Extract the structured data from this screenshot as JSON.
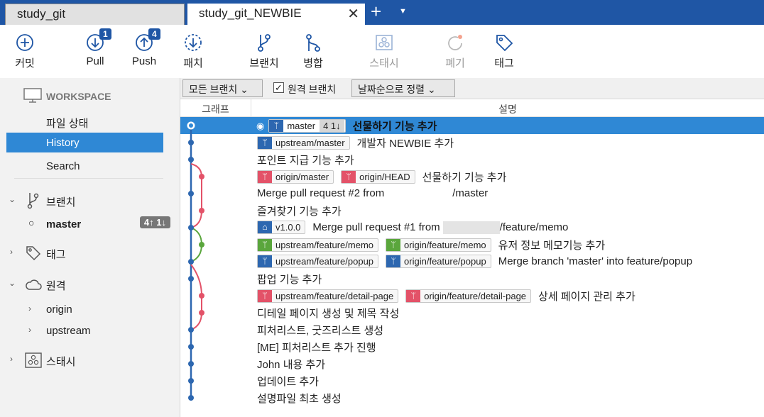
{
  "tabs": [
    {
      "label": "study_git"
    },
    {
      "label": "study_git_NEWBIE"
    }
  ],
  "tab_close": "✕",
  "add_tab": "+",
  "tab_menu": "▼",
  "toolbar": {
    "commit": "커밋",
    "pull": "Pull",
    "pull_badge": "1",
    "push": "Push",
    "push_badge": "4",
    "patch": "패치",
    "branch": "브랜치",
    "merge": "병합",
    "stash": "스태시",
    "discard": "폐기",
    "tag": "태그"
  },
  "sidebar": {
    "workspace": "WORKSPACE",
    "file_status": "파일 상태",
    "history": "History",
    "search": "Search",
    "branches": "브랜치",
    "master": "master",
    "master_count": "4↑ 1↓",
    "tags": "태그",
    "remotes": "원격",
    "origin": "origin",
    "upstream": "upstream",
    "stash": "스태시"
  },
  "filter": {
    "all_branches": "모든 브랜치 ⌄",
    "remote_branches": "원격 브랜치",
    "remote_checked": "✓",
    "sort": "날짜순으로 정렬 ⌄"
  },
  "columns": {
    "graph": "그래프",
    "desc": "설명"
  },
  "commits": [
    {
      "refs": [
        {
          "name": "master",
          "kind": "head",
          "count": "4 1↓"
        }
      ],
      "msg": "선물하기 기능 추가"
    },
    {
      "refs": [
        {
          "name": "upstream/master",
          "kind": "blue"
        }
      ],
      "msg": "개발자 NEWBIE 추가"
    },
    {
      "refs": [],
      "msg": "포인트 지급 기능 추가"
    },
    {
      "refs": [
        {
          "name": "origin/master",
          "kind": "red"
        },
        {
          "name": "origin/HEAD",
          "kind": "red"
        }
      ],
      "msg": "선물하기 기능 추가"
    },
    {
      "refs": [],
      "msg": "Merge pull request #2 from",
      "msg_tail": "/master"
    },
    {
      "refs": [],
      "msg": "즐겨찾기 기능 추가"
    },
    {
      "refs": [
        {
          "name": "v1.0.0",
          "kind": "tag"
        }
      ],
      "msg": "Merge pull request #1 from",
      "msg_tail": "/feature/memo"
    },
    {
      "refs": [
        {
          "name": "upstream/feature/memo",
          "kind": "green"
        },
        {
          "name": "origin/feature/memo",
          "kind": "green"
        }
      ],
      "msg": "유저 정보 메모기능 추가"
    },
    {
      "refs": [
        {
          "name": "upstream/feature/popup",
          "kind": "blue"
        },
        {
          "name": "origin/feature/popup",
          "kind": "blue"
        }
      ],
      "msg": "Merge branch 'master' into feature/popup"
    },
    {
      "refs": [],
      "msg": "팝업 기능 추가"
    },
    {
      "refs": [
        {
          "name": "upstream/feature/detail-page",
          "kind": "red"
        },
        {
          "name": "origin/feature/detail-page",
          "kind": "red"
        }
      ],
      "msg": "상세 페이지 관리 추가"
    },
    {
      "refs": [],
      "msg": "디테일 페이지 생성 및 제목 작성"
    },
    {
      "refs": [],
      "msg": "피처리스트, 굿즈리스트 생성"
    },
    {
      "refs": [],
      "msg": "[ME] 피처리스트 추가 진행"
    },
    {
      "refs": [],
      "msg": "John 내용 추가"
    },
    {
      "refs": [],
      "msg": "업데이트 추가"
    },
    {
      "refs": [],
      "msg": "설명파일 최초 생성"
    }
  ],
  "colors": {
    "accent": "#1f56a5",
    "selection": "#2f88d5",
    "main_line": "#2d67b0",
    "red_line": "#e35268",
    "green_line": "#5aa63c"
  }
}
